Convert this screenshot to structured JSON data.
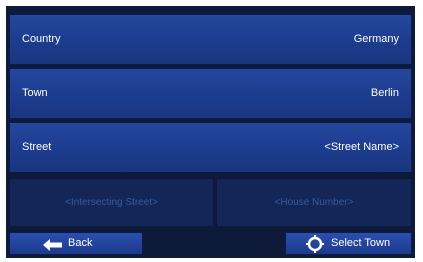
{
  "form": {
    "country": {
      "label": "Country",
      "value": "Germany"
    },
    "town": {
      "label": "Town",
      "value": "Berlin"
    },
    "street": {
      "label": "Street",
      "value": "<Street Name>"
    },
    "intersecting_street": {
      "placeholder": "<Intersecting Street>"
    },
    "house_number": {
      "placeholder": "<House Number>"
    }
  },
  "toolbar": {
    "back_label": "Back",
    "back_icon": "arrow-left-icon",
    "select_label": "Select Town",
    "select_icon": "crosshair-target-icon"
  },
  "colors": {
    "row": "#1e3f92",
    "disabled_row": "#132657",
    "background": "#0d1a3a",
    "text": "#ffffff",
    "disabled_text": "#3a5a9a"
  }
}
